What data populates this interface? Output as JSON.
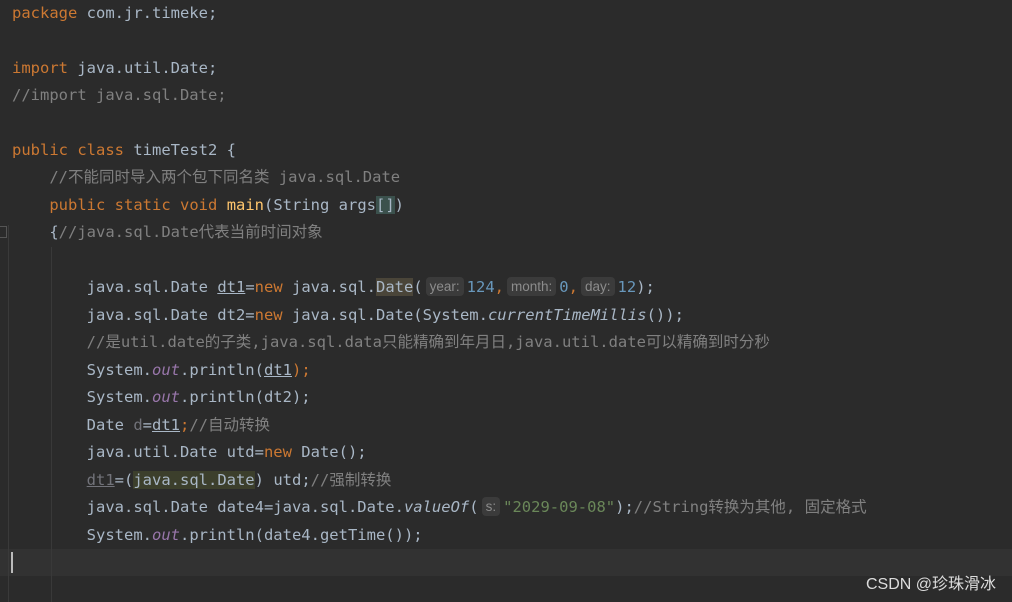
{
  "code": {
    "l1": {
      "kw": "package",
      "rest": " com.jr.timeke;"
    },
    "l3": {
      "kw": "import",
      "rest": " java.util.Date;"
    },
    "l4": {
      "comment": "//import java.sql.Date;"
    },
    "l6": {
      "kw1": "public",
      "kw2": "class",
      "rest": " timeTest2 {"
    },
    "l7": {
      "comment": "//不能同时导入两个包下同名类 java.sql.Date"
    },
    "l8": {
      "kw1": "public",
      "kw2": "static",
      "kw3": "void",
      "method": "main",
      "params": "(String args",
      "brackets": "[]",
      "close": ")"
    },
    "l9": {
      "brace": "{",
      "comment": "//java.sql.Date代表当前时间对象"
    },
    "l11": {
      "type": "java.sql.Date ",
      "var": "dt1",
      "eq": "=",
      "kw": "new",
      "pkg": " java.sql.",
      "cls": "Date",
      "paren": "(",
      "hint_year": "year:",
      "v_year": "124",
      "comma1": ",",
      "hint_month": "month:",
      "v_month": "0",
      "comma2": ",",
      "hint_day": "day:",
      "v_day": "12",
      "close": ");"
    },
    "l12": {
      "pre": "java.sql.Date dt2=",
      "kw": "new",
      "mid": " java.sql.Date(System.",
      "static_call": "currentTimeMillis",
      "close": "());"
    },
    "l13": {
      "comment": "//是util.date的子类,java.sql.data只能精确到年月日,java.util.date可以精确到时分秒"
    },
    "l14": {
      "pre": "System.",
      "field": "out",
      "mid": ".println(",
      "arg": "dt1",
      "close": ");"
    },
    "l15": {
      "pre": "System.",
      "field": "out",
      "mid": ".println(dt2);"
    },
    "l16": {
      "pre": "Date ",
      "var": "d",
      "eq": "=",
      "arg": "dt1",
      "semi": ";",
      "comment": "//自动转换"
    },
    "l17": {
      "pre": "java.util.Date utd=",
      "kw": "new",
      "rest": " Date();"
    },
    "l18": {
      "var": "dt1",
      "eq": "=(",
      "cast": "java.sql.Date",
      "rest": ") utd;",
      "comment": "//强制转换"
    },
    "l19": {
      "pre": "java.sql.Date date4=java.sql.Date.",
      "static_call": "valueOf",
      "paren": "(",
      "hint_s": "s:",
      "str": "\"2029-09-08\"",
      "close": ");",
      "comment": "//String转换为其他, 固定格式"
    },
    "l20": {
      "pre": "System.",
      "field": "out",
      "rest": ".println(date4.getTime());"
    }
  },
  "watermark": "CSDN @珍珠滑冰",
  "colors": {
    "background": "#2b2b2b",
    "keyword": "#cc7832",
    "comment": "#808080",
    "method_decl": "#ffc66d",
    "number": "#6897bb",
    "string": "#6a8759",
    "field": "#9876aa",
    "text": "#a9b7c6"
  }
}
